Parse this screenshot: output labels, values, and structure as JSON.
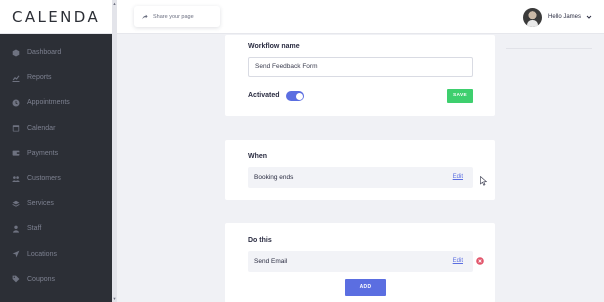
{
  "app": {
    "logo": "CALENDA"
  },
  "sidebar": {
    "items": [
      {
        "label": "Dashboard",
        "icon": "cube-icon"
      },
      {
        "label": "Reports",
        "icon": "chart-icon"
      },
      {
        "label": "Appointments",
        "icon": "clock-icon"
      },
      {
        "label": "Calendar",
        "icon": "calendar-icon"
      },
      {
        "label": "Payments",
        "icon": "wallet-icon"
      },
      {
        "label": "Customers",
        "icon": "users-icon"
      },
      {
        "label": "Services",
        "icon": "layers-icon"
      },
      {
        "label": "Staff",
        "icon": "user-icon"
      },
      {
        "label": "Locations",
        "icon": "location-arrow-icon"
      },
      {
        "label": "Coupons",
        "icon": "tag-icon"
      }
    ]
  },
  "topbar": {
    "share_label": "Share your page",
    "user_name": "Hello James"
  },
  "workflow": {
    "name_label": "Workflow name",
    "name_value": "Send Feedback Form",
    "activated_label": "Activated",
    "activated": true,
    "save_label": "SAVE"
  },
  "when": {
    "title": "When",
    "trigger_label": "Booking ends",
    "edit_label": "Edit"
  },
  "do_this": {
    "title": "Do this",
    "action_label": "Send Email",
    "edit_label": "Edit",
    "add_label": "ADD"
  },
  "colors": {
    "accent": "#5b6ee1",
    "save_green": "#3ecf6e",
    "sidebar_bg": "#2c2f36",
    "remove_red": "#e2556b"
  }
}
